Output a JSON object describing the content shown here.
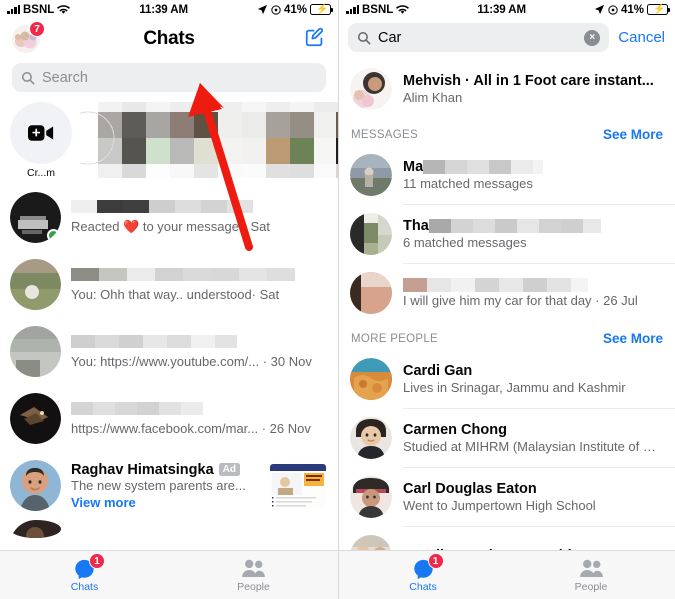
{
  "status_bar": {
    "carrier": "BSNL",
    "time": "11:39 AM",
    "battery_pct": "41%"
  },
  "left": {
    "nav": {
      "title": "Chats",
      "avatar_badge": "7",
      "compose_icon": "compose-icon"
    },
    "search": {
      "placeholder": "Search",
      "icon": "search-icon"
    },
    "stories": [
      {
        "label": "Cr...m",
        "type": "create-room"
      },
      {
        "label": "",
        "type": "story"
      },
      {
        "label": "",
        "type": "story"
      },
      {
        "label": "",
        "type": "story"
      },
      {
        "label": "",
        "type": "story"
      }
    ],
    "chats": [
      {
        "preview": "Reacted ❤️ to your message · Sat",
        "online": true
      },
      {
        "preview": "You: Ohh that way.. understood· Sat",
        "online": false
      },
      {
        "preview": "You: https://www.youtube.com/... · 30 Nov",
        "online": false
      },
      {
        "preview": "https://www.facebook.com/mar... · 26 Nov",
        "online": false
      }
    ],
    "ad": {
      "name": "Raghav Himatsingka",
      "tag": "Ad",
      "preview": "The new system parents are...",
      "cta": "View more"
    }
  },
  "right": {
    "search": {
      "value": "Car",
      "icon": "search-icon",
      "clear": "×",
      "cancel": "Cancel"
    },
    "top_result": {
      "title": "Mehvish · All in 1 Foot care instant...",
      "subtitle": "Alim Khan"
    },
    "messages_section": {
      "title": "MESSAGES",
      "see_more": "See More",
      "items": [
        {
          "name_visible": "Ma",
          "sub": "11 matched messages"
        },
        {
          "name_visible": "Tha",
          "sub": "6 matched messages"
        },
        {
          "name_visible": "",
          "sub": "I will give him my car for that day · 26 Jul"
        }
      ]
    },
    "people_section": {
      "title": "MORE PEOPLE",
      "see_more": "See More",
      "items": [
        {
          "name": "Cardi Gan",
          "sub": "Lives in Srinagar, Jammu and Kashmir"
        },
        {
          "name": "Carmen Chong",
          "sub": "Studied at MIHRM (Malaysian Institute of Hum..."
        },
        {
          "name": "Carl Douglas Eaton",
          "sub": "Went to Jumpertown High School"
        },
        {
          "name": "Caroline Anderson Smith",
          "sub": ""
        }
      ]
    }
  },
  "tabbar": {
    "chats": {
      "label": "Chats",
      "badge": "1",
      "icon": "messenger-chat-icon"
    },
    "people": {
      "label": "People",
      "icon": "people-icon"
    }
  },
  "annotation": {
    "arrow_color": "#ee1b11",
    "points_to": "search-input"
  }
}
